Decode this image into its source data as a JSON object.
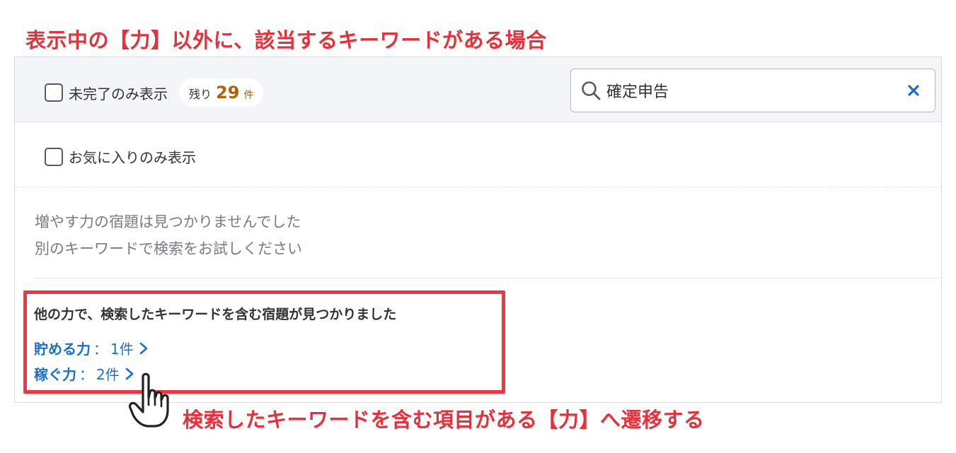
{
  "annotations": {
    "top": "表示中の【力】以外に、該当するキーワードがある場合",
    "bottom": "検索したキーワードを含む項目がある【力】へ遷移する"
  },
  "filters": {
    "incomplete_only_label": "未完了のみ表示",
    "remaining_prefix": "残り",
    "remaining_count": "29",
    "remaining_unit": "件",
    "favorites_only_label": "お気に入りのみ表示"
  },
  "search": {
    "value": "確定申告",
    "icon": "search-icon",
    "clear_icon": "close-icon"
  },
  "empty_state": {
    "line1": "増やす力の宿題は見つかりませんでした",
    "line2": "別のキーワードで検索をお試しください"
  },
  "other_results": {
    "heading": "他の力で、検索したキーワードを含む宿題が見つかりました",
    "links": [
      {
        "name": "貯める力",
        "separator": "：",
        "count": "1件"
      },
      {
        "name": "稼ぐ力",
        "separator": "：",
        "count": "2件"
      }
    ]
  },
  "colors": {
    "annotation_red": "#e8303a",
    "link_blue": "#1a6fc9",
    "count_accent": "#a8650a"
  }
}
